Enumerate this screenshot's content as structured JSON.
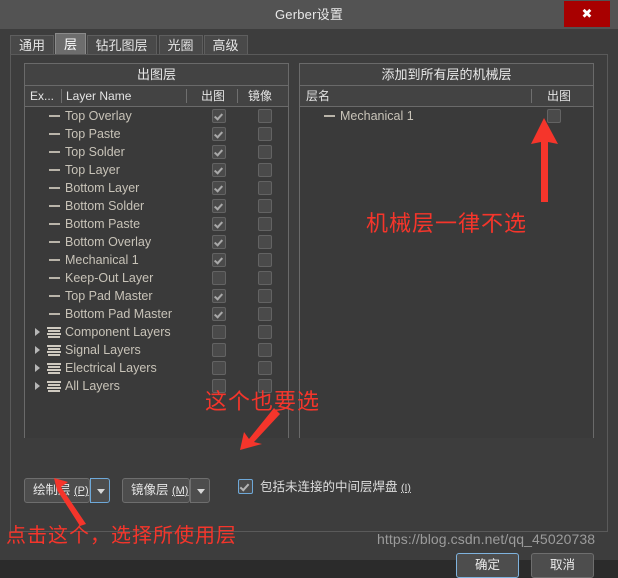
{
  "window": {
    "title": "Gerber设置",
    "close_label": "✖"
  },
  "tabs": [
    {
      "label": "通用",
      "active": false
    },
    {
      "label": "层",
      "active": true
    },
    {
      "label": "钻孔图层",
      "active": false
    },
    {
      "label": "光圈",
      "active": false
    },
    {
      "label": "高级",
      "active": false
    }
  ],
  "left_panel": {
    "title": "出图层",
    "columns": {
      "extra": "Ex...",
      "layer_name": "Layer Name",
      "plot": "出图",
      "mirror": "镜像"
    },
    "rows": [
      {
        "label": "Top Overlay",
        "type": "layer",
        "plot": true,
        "mirror": false
      },
      {
        "label": "Top Paste",
        "type": "layer",
        "plot": true,
        "mirror": false
      },
      {
        "label": "Top Solder",
        "type": "layer",
        "plot": true,
        "mirror": false
      },
      {
        "label": "Top Layer",
        "type": "layer",
        "plot": true,
        "mirror": false
      },
      {
        "label": "Bottom Layer",
        "type": "layer",
        "plot": true,
        "mirror": false
      },
      {
        "label": "Bottom Solder",
        "type": "layer",
        "plot": true,
        "mirror": false
      },
      {
        "label": "Bottom Paste",
        "type": "layer",
        "plot": true,
        "mirror": false
      },
      {
        "label": "Bottom Overlay",
        "type": "layer",
        "plot": true,
        "mirror": false
      },
      {
        "label": "Mechanical 1",
        "type": "layer",
        "plot": true,
        "mirror": false
      },
      {
        "label": "Keep-Out Layer",
        "type": "layer",
        "plot": false,
        "mirror": false
      },
      {
        "label": "Top Pad Master",
        "type": "layer",
        "plot": true,
        "mirror": false
      },
      {
        "label": "Bottom Pad Master",
        "type": "layer",
        "plot": true,
        "mirror": false
      },
      {
        "label": "Component Layers",
        "type": "group",
        "plot": false,
        "mirror": false
      },
      {
        "label": "Signal Layers",
        "type": "group",
        "plot": false,
        "mirror": false
      },
      {
        "label": "Electrical Layers",
        "type": "group",
        "plot": false,
        "mirror": false
      },
      {
        "label": "All Layers",
        "type": "group",
        "plot": false,
        "mirror": false
      }
    ]
  },
  "right_panel": {
    "title": "添加到所有层的机械层",
    "columns": {
      "layer_name": "层名",
      "plot": "出图"
    },
    "rows": [
      {
        "label": "Mechanical 1",
        "type": "layer",
        "plot": false
      }
    ]
  },
  "bottom_controls": {
    "plot_layers_button": {
      "label": "绘制层",
      "mnemonic": "(P)"
    },
    "mirror_layers_button": {
      "label": "镜像层",
      "mnemonic": "(M)"
    },
    "include_unconnected": {
      "label": "包括未连接的中间层焊盘",
      "mnemonic": "(I)",
      "checked": true
    }
  },
  "footer": {
    "ok_label": "确定",
    "cancel_label": "取消"
  },
  "watermark": "https://blog.csdn.net/qq_45020738",
  "annotations": [
    {
      "text": "机械层一律不选"
    },
    {
      "text": "这个也要选"
    },
    {
      "text": "点击这个，选择所使用层"
    }
  ],
  "colors": {
    "accent_red": "#f5352b",
    "close_red": "#a80000",
    "focus_blue": "#6ea8d8",
    "layer_text": "#c8c3b8"
  }
}
